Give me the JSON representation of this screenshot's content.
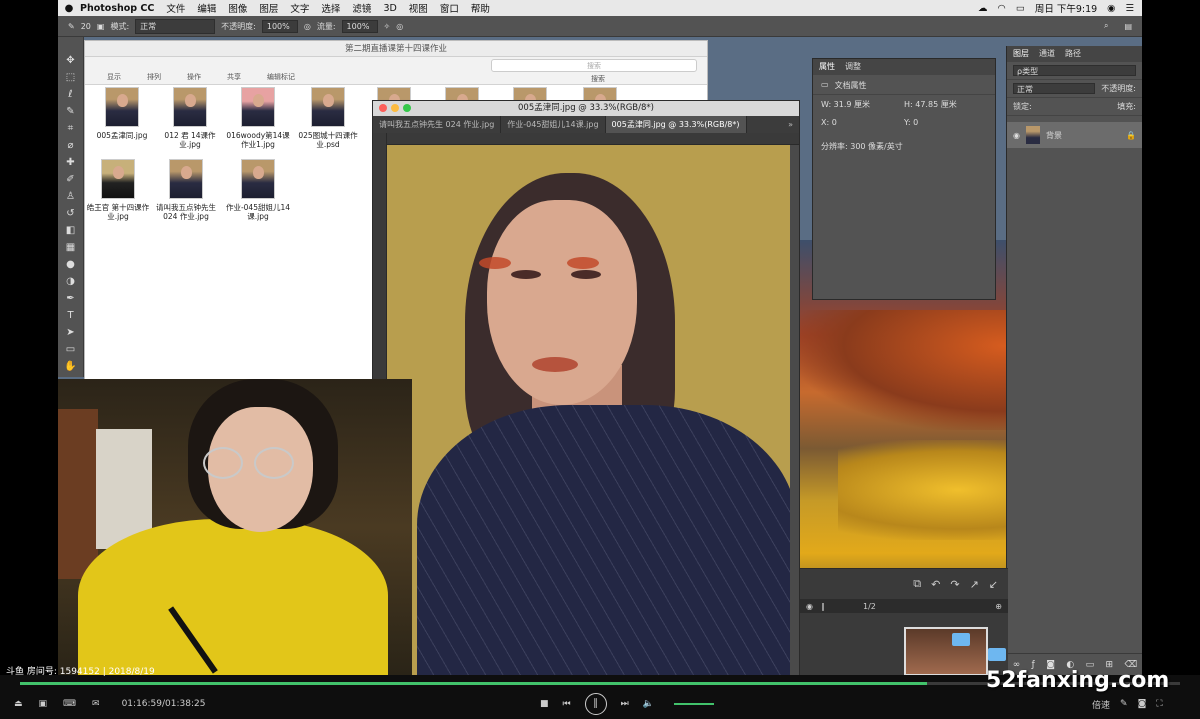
{
  "menubar": {
    "app": "Photoshop CC",
    "items": [
      "文件",
      "编辑",
      "图像",
      "图层",
      "文字",
      "选择",
      "滤镜",
      "3D",
      "视图",
      "窗口",
      "帮助"
    ],
    "clock": "周日 下午9:19"
  },
  "options": {
    "brush_size": "20",
    "mode_label": "模式:",
    "mode_value": "正常",
    "opacity_label": "不透明度:",
    "opacity_value": "100%",
    "flow_label": "流量:",
    "flow_value": "100%"
  },
  "finder": {
    "title": "第二期直播课第十四课作业",
    "toolbar": [
      "显示",
      "排列",
      "操作",
      "共享",
      "编辑标记"
    ],
    "search_placeholder": "搜索",
    "search_label": "搜索",
    "files": [
      {
        "name": "005孟津同.jpg",
        "style": "normal"
      },
      {
        "name": "012 君 14课作业.jpg",
        "style": "normal"
      },
      {
        "name": "016woody第14课作业1.jpg",
        "style": "pink"
      },
      {
        "name": "025图城十四课作业.psd",
        "style": "normal"
      },
      {
        "name": "皓王官 第十四课作业.jpg",
        "style": "olive"
      },
      {
        "name": "请叫我五点钟先生024 作业.jpg",
        "style": "normal"
      },
      {
        "name": "作业-045甜姐儿14课.jpg",
        "style": "normal"
      }
    ]
  },
  "document": {
    "title": "005孟津同.jpg @ 33.3%(RGB/8*)",
    "tabs": [
      "请叫我五点钟先生 024 作业.jpg",
      "作业-045甜姐儿14课.jpg",
      "005孟津同.jpg @ 33.3%(RGB/8*)"
    ],
    "active_tab": 2
  },
  "properties": {
    "tabs": [
      "属性",
      "调整"
    ],
    "section": "文档属性",
    "w": "W: 31.9 厘米",
    "h": "H: 47.85 厘米",
    "x": "X: 0",
    "y": "Y: 0",
    "resolution": "分辨率: 300 像素/英寸"
  },
  "layers": {
    "tabs": [
      "图层",
      "通道",
      "路径"
    ],
    "filter": "ρ类型",
    "blend": "正常",
    "opacity": "不透明度:",
    "lock": "锁定:",
    "fill": "填充:",
    "layer_name": "背景"
  },
  "mini": {
    "page": "1/2"
  },
  "stream": {
    "room": "斗鱼 房间号: 1594152 | 2018/8/19"
  },
  "player": {
    "time": "01:16:59/01:38:25",
    "progress": 0.782,
    "speed": "倍速"
  },
  "watermark": "52fanxing.com"
}
